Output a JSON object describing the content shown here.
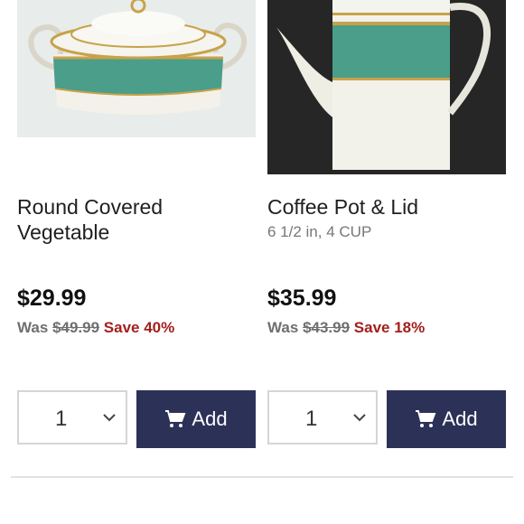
{
  "products": [
    {
      "name_line1": "Round Covered",
      "name_line2": "Vegetable",
      "subtitle": "",
      "price": "$29.99",
      "was_label": "Was",
      "was_price": "$49.99",
      "save_text": "Save 40%",
      "quantity": "1",
      "add_label": "Add"
    },
    {
      "name_line1": "Coffee Pot & Lid",
      "name_line2": "",
      "subtitle": "6 1/2 in, 4 CUP",
      "price": "$35.99",
      "was_label": "Was",
      "was_price": "$43.99",
      "save_text": "Save 18%",
      "quantity": "1",
      "add_label": "Add"
    }
  ],
  "colors": {
    "save_red": "#a41e1e",
    "button_navy": "#2c3158",
    "band_teal": "#4a9e8a",
    "gold": "#c8a24a"
  }
}
